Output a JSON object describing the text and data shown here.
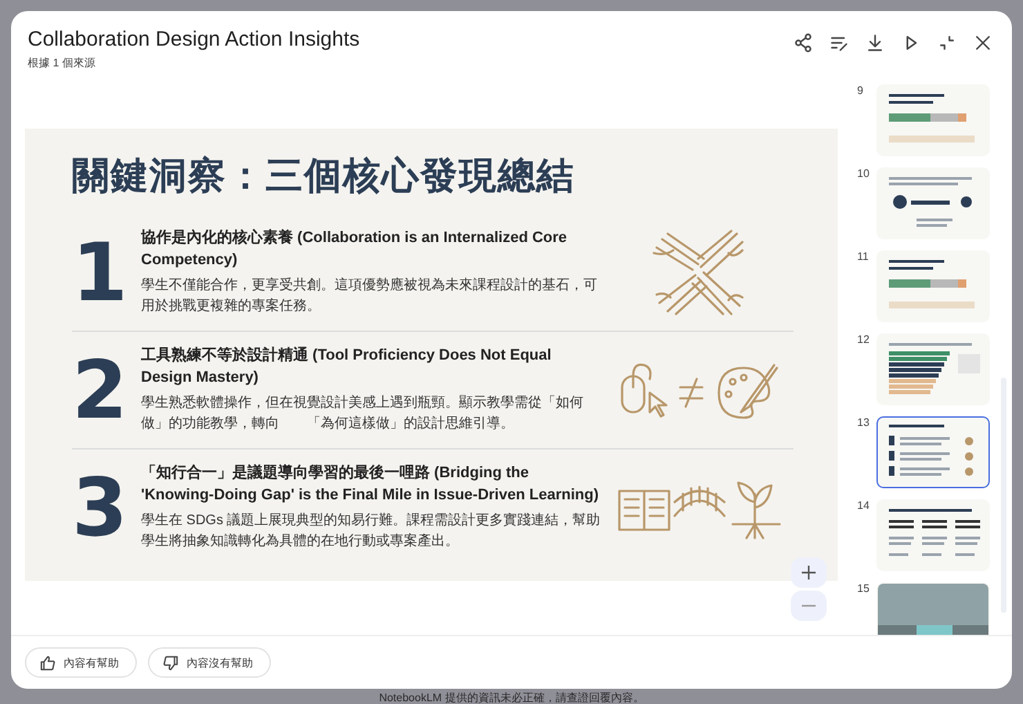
{
  "window": {
    "title": "Collaboration Design Action Insights",
    "subtitle": "根據 1 個來源"
  },
  "slide": {
    "title": "關鍵洞察：三個核心發現總結",
    "points": [
      {
        "number": "1",
        "heading": "協作是內化的核心素養 (Collaboration is an Internalized Core Competency)",
        "body": "學生不僅能合作，更享受共創。這項優勢應被視為未來課程設計的基石，可用於挑戰更複雜的專案任務。"
      },
      {
        "number": "2",
        "heading": "工具熟練不等於設計精通 (Tool Proficiency Does Not Equal Design Mastery)",
        "body": "學生熟悉軟體操作，但在視覺設計美感上遇到瓶頸。顯示教學需從「如何做」的功能教學，轉向　　「為何這樣做」的設計思維引導。"
      },
      {
        "number": "3",
        "heading": "「知行合一」是議題導向學習的最後一哩路 (Bridging the 'Knowing-Doing Gap' is the Final Mile in Issue-Driven Learning)",
        "body": "學生在 SDGs 議題上展現典型的知易行難。課程需設計更多實踐連結，幫助學生將抽象知識轉化為具體的在地行動或專案產出。"
      }
    ]
  },
  "thumbnails": [
    {
      "number": "9",
      "kind": "bars",
      "selected": false
    },
    {
      "number": "10",
      "kind": "flow",
      "selected": false
    },
    {
      "number": "11",
      "kind": "bars",
      "selected": false
    },
    {
      "number": "12",
      "kind": "chart",
      "selected": false
    },
    {
      "number": "13",
      "kind": "list",
      "selected": true
    },
    {
      "number": "14",
      "kind": "columns",
      "selected": false
    },
    {
      "number": "15",
      "kind": "image",
      "selected": false
    }
  ],
  "feedback_buttons": [
    {
      "label": "內容有幫助",
      "kind": "thumbs-up"
    },
    {
      "label": "內容沒有幫助",
      "kind": "thumbs-down"
    }
  ],
  "disclaimer": "NotebookLM 提供的資訊未必正確，請查證回覆內容。"
}
